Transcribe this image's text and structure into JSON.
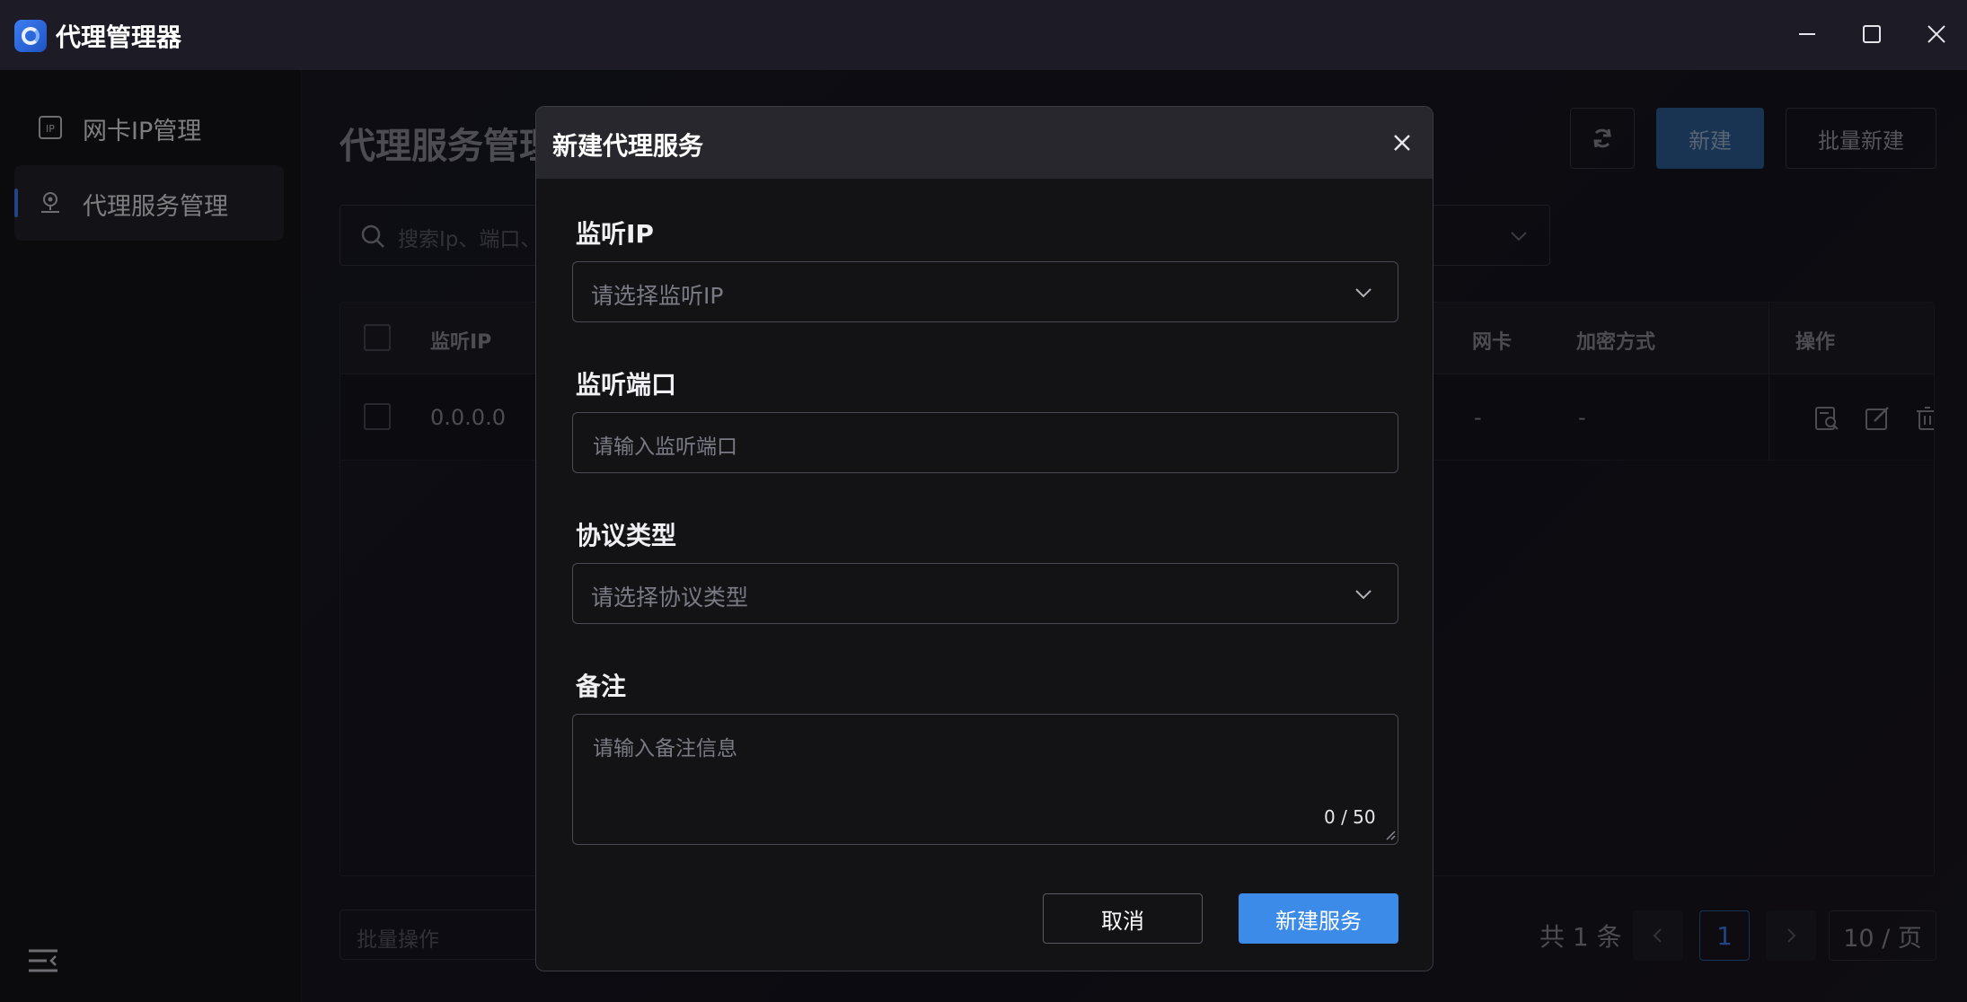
{
  "app": {
    "title": "代理管理器"
  },
  "sidebar": {
    "items": [
      {
        "label": "网卡IP管理",
        "icon": "ip-icon"
      },
      {
        "label": "代理服务管理",
        "icon": "proxy-node-icon",
        "active": true
      }
    ]
  },
  "main": {
    "title": "代理服务管理",
    "buttons": {
      "new": "新建",
      "batch_new": "批量新建"
    },
    "search": {
      "placeholder": "搜索Ip、端口、"
    },
    "table": {
      "headers": [
        "监听IP",
        "网卡",
        "加密方式",
        "操作"
      ],
      "rows": [
        {
          "listen_ip": "0.0.0.0",
          "nic": "-",
          "encryption": "-"
        }
      ]
    },
    "footer": {
      "bulk_placeholder": "批量操作",
      "total": "共 1 条",
      "current_page": "1",
      "page_size": "10 / 页"
    }
  },
  "modal": {
    "title": "新建代理服务",
    "fields": {
      "listen_ip": {
        "label": "监听IP",
        "placeholder": "请选择监听IP"
      },
      "listen_port": {
        "label": "监听端口",
        "placeholder": "请输入监听端口"
      },
      "protocol": {
        "label": "协议类型",
        "placeholder": "请选择协议类型"
      },
      "note": {
        "label": "备注",
        "placeholder": "请输入备注信息",
        "counter": "0 / 50"
      }
    },
    "buttons": {
      "cancel": "取消",
      "create": "新建服务"
    }
  },
  "colors": {
    "accent": "#3d8be8",
    "sidebar_marker": "#3d7cf0",
    "background": "#121218"
  }
}
